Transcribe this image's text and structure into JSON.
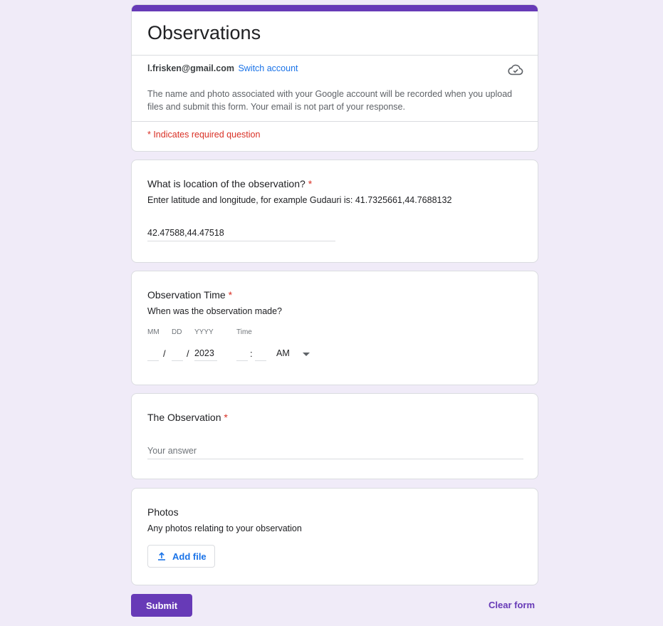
{
  "form": {
    "title": "Observations",
    "accent_color": "#673ab7",
    "account_email": "l.frisken@gmail.com",
    "switch_account_label": "Switch account",
    "notice": "The name and photo associated with your Google account will be recorded when you upload files and submit this form. Your email is not part of your response.",
    "required_note": "* Indicates required question",
    "cloud_icon": "cloud-saved-icon"
  },
  "questions": {
    "location": {
      "title": "What is location of the observation?",
      "required_marker": "*",
      "help": "Enter latitude and longitude, for example Gudauri is: 41.7325661,44.7688132",
      "value": "42.47588,44.47518"
    },
    "time": {
      "title": "Observation Time",
      "required_marker": "*",
      "help": "When was the observation made?",
      "label_mm": "MM",
      "label_dd": "DD",
      "label_yyyy": "YYYY",
      "label_time": "Time",
      "mm_value": "",
      "dd_value": "",
      "yyyy_value": "2023",
      "date_sep": "/",
      "time_sep": ":",
      "ampm": "AM"
    },
    "observation": {
      "title": "The Observation",
      "required_marker": "*",
      "placeholder": "Your answer"
    },
    "photos": {
      "title": "Photos",
      "help": "Any photos relating to your observation",
      "add_file_label": "Add file"
    }
  },
  "actions": {
    "submit_label": "Submit",
    "clear_label": "Clear form"
  }
}
